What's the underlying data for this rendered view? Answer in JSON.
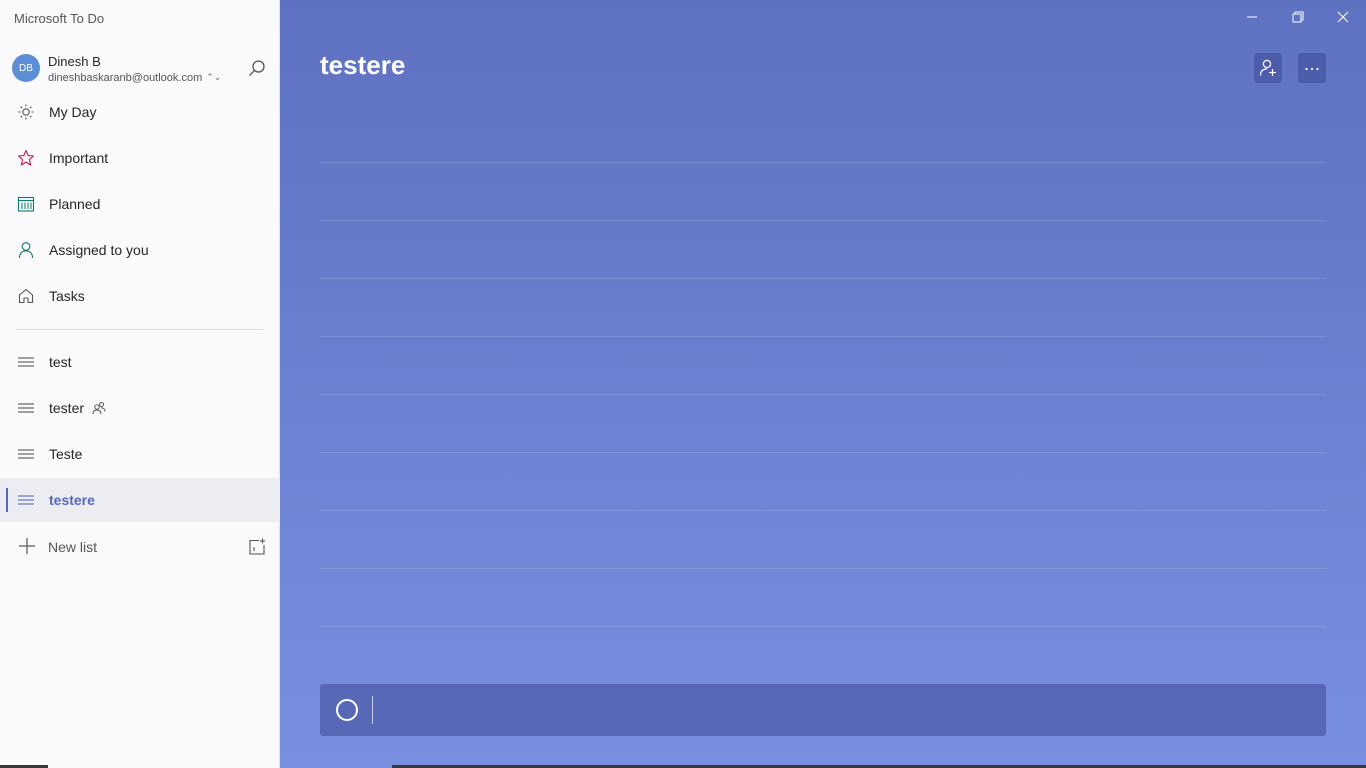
{
  "app": {
    "title": "Microsoft To Do"
  },
  "account": {
    "initials": "DB",
    "name": "Dinesh B",
    "email": "dineshbaskaranb@outlook.com"
  },
  "sidebar": {
    "smart_lists": [
      {
        "label": "My Day",
        "icon": "sun-icon"
      },
      {
        "label": "Important",
        "icon": "star-icon"
      },
      {
        "label": "Planned",
        "icon": "calendar-icon"
      },
      {
        "label": "Assigned to you",
        "icon": "person-icon"
      },
      {
        "label": "Tasks",
        "icon": "home-icon"
      }
    ],
    "lists": [
      {
        "label": "test",
        "icon": "list-icon",
        "shared": false
      },
      {
        "label": "tester",
        "icon": "list-icon",
        "shared": true
      },
      {
        "label": "Teste",
        "icon": "list-icon",
        "shared": false
      },
      {
        "label": "testere",
        "icon": "list-icon",
        "shared": false,
        "selected": true
      }
    ],
    "new_list_label": "New list"
  },
  "main": {
    "list_title": "testere",
    "add_task_placeholder": ""
  },
  "colors": {
    "accent": "#5868b8",
    "background_top": "#5f72c2",
    "background_bottom": "#788ede",
    "important_star": "#c2185b",
    "planned_icon": "#0f7b6c"
  }
}
